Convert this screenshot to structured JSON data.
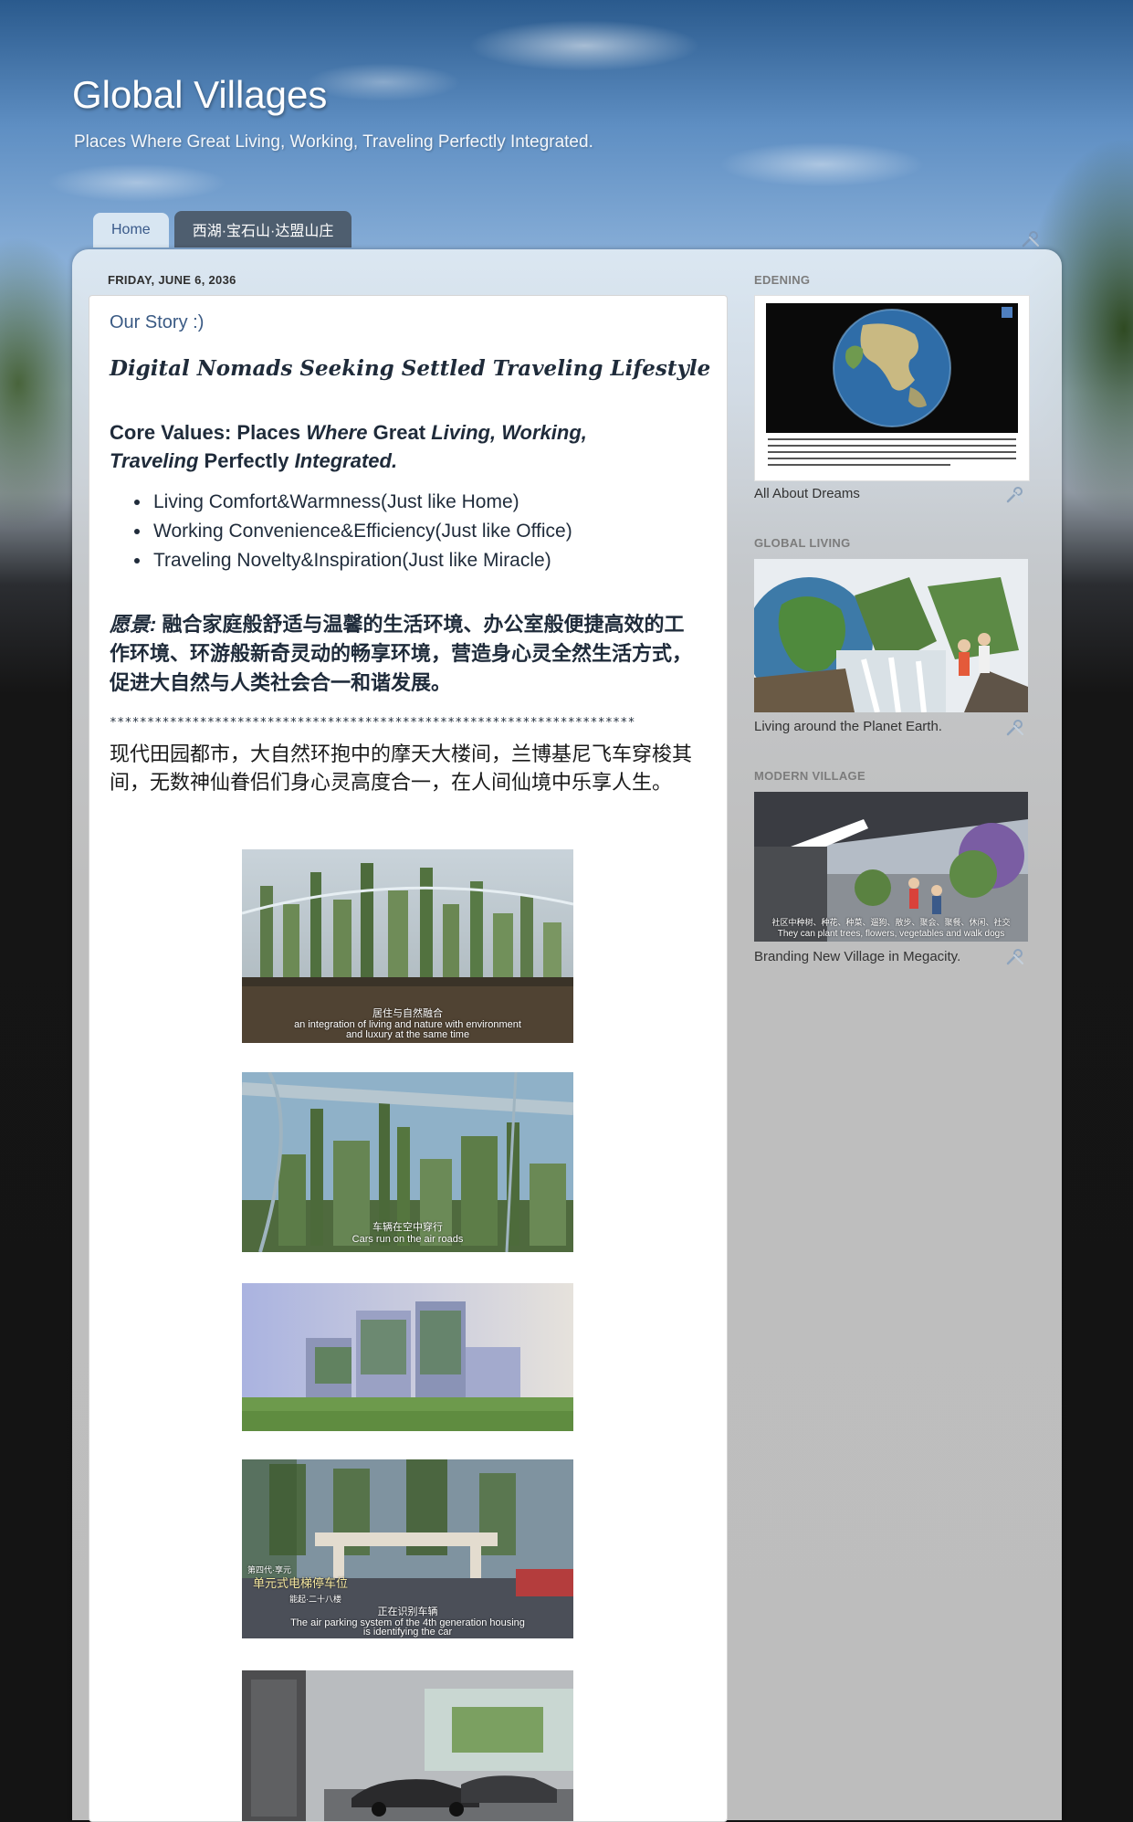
{
  "header": {
    "title": "Global Villages",
    "description": "Places Where Great Living, Working, Traveling Perfectly Integrated."
  },
  "tabs": [
    {
      "label": "Home",
      "active": false
    },
    {
      "label": "西湖·宝石山·达盟山庄",
      "active": true
    }
  ],
  "post": {
    "date": "FRIDAY, JUNE 6, 2036",
    "title": "Our Story :)",
    "subtitle": "Digital Nomads Seeking Settled Traveling Lifestyle",
    "core_values": {
      "part1": "Core Values: Places ",
      "part2": "Where",
      "part3": " Great ",
      "part4": "Living, Working, Traveling",
      "part5": " Perfectly ",
      "part6": "Integrated."
    },
    "values_list": [
      "Living Comfort&Warmness(Just like Home)",
      "Working Convenience&Efficiency(Just like Office)",
      "Traveling Novelty&Inspiration(Just like Miracle)"
    ],
    "vision_label": "愿景:",
    "vision_text": " 融合家庭般舒适与温馨的生活环境、办公室般便捷高效的工作环境、环游般新奇灵动的畅享环境，营造身心灵全然生活方式，促进大自然与人类社会合一和谐发展。",
    "divider": "**********************************************************************",
    "story_text": "现代田园都市，大自然环抱中的摩天大楼间，兰博基尼飞车穿梭其间，无数神仙眷侣们身心灵高度合一，在人间仙境中乐享人生。",
    "photos": [
      {
        "caption_cn": "居住与自然融合",
        "caption_en": "an integration of living and nature with environment",
        "caption_en2": "and luxury at the same time"
      },
      {
        "caption_cn": "车辆在空中穿行",
        "caption_en": "Cars run on the air roads"
      },
      {},
      {
        "caption_cn": "正在识别车辆",
        "caption_en": "The air parking system of the 4th generation housing",
        "caption_en2": "is identifying the car",
        "overlay_cn1": "第四代·享元",
        "overlay_cn2": "单元式电梯停车位",
        "overlay_cn3": "能起·二十八楼"
      },
      {}
    ]
  },
  "sidebar": {
    "widgets": [
      {
        "title": "EDENING",
        "caption": "All About Dreams"
      },
      {
        "title": "GLOBAL LIVING",
        "caption": "Living around the Planet Earth."
      },
      {
        "title": "MODERN VILLAGE",
        "caption": "Branding New Village in Megacity.",
        "overlay_cn": "社区中种树、种花、种菜、遛狗、散步、聚会、聚餐、休闲、社交",
        "overlay_en": "They can plant trees, flowers, vegetables and walk dogs"
      }
    ]
  },
  "colors": {
    "tab_active_bg": "#4e5e6f",
    "tab_home_bg": "#d8e6f2",
    "post_title": "#3a5a84",
    "text_dark": "#1f2b3a"
  },
  "icons": [
    "wrench-screwdriver-icon",
    "globe-icon"
  ]
}
